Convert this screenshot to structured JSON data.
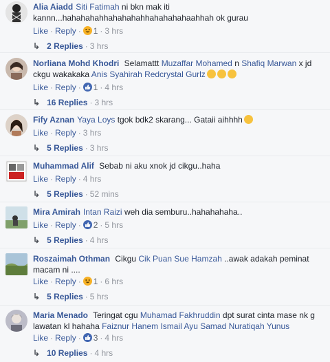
{
  "actions": {
    "like": "Like",
    "reply": "Reply",
    "sep": "·"
  },
  "comments": [
    {
      "author": "Alia Aiadd",
      "tag": "Siti Fatimah",
      "text": " ni bkn mak iti kannn...hahahahahhahahahahhahahahahaahhah ok gurau",
      "reaction": "haha",
      "reaction_count": "1",
      "time": "3 hrs",
      "replies": "2 Replies",
      "replies_time": "3 hrs"
    },
    {
      "author": "Norliana Mohd Khodri",
      "text_a": " Selamattt ",
      "tag_a": "Muzaffar Mohamed",
      "text_b": " n ",
      "tag_b": "Shafiq Marwan",
      "text_c": " x jd ckgu wakakaka ",
      "tag_c": "Anis Syahirah Redcrystal Gurlz",
      "emoji_count": 3,
      "reaction": "like",
      "reaction_count": "1",
      "time": "4 hrs",
      "replies": "16 Replies",
      "replies_time": "3 hrs"
    },
    {
      "author": "Fify Aznan",
      "tag": "Yaya Loys",
      "text": " tgok bdk2 skarang... Gataii aihhhh",
      "time": "3 hrs",
      "replies": "5 Replies",
      "replies_time": "3 hrs"
    },
    {
      "author": "Muhammad Alif",
      "text": " Sebab ni aku xnok jd cikgu..haha",
      "time": "4 hrs",
      "replies": "5 Replies",
      "replies_time": "52 mins"
    },
    {
      "author": "Mira Amirah",
      "tag": "Intan Raizi",
      "text": " weh dia semburu..hahahahaha..",
      "reaction": "like",
      "reaction_count": "2",
      "time": "5 hrs",
      "replies": "5 Replies",
      "replies_time": "4 hrs"
    },
    {
      "author": "Roszaimah Othman",
      "text_a": " Cikgu ",
      "tag": "Cik Puan Sue Hamzah",
      "text_b": " ..awak adakah peminat macam ni ....",
      "reaction": "haha",
      "reaction_count": "1",
      "time": "6 hrs",
      "replies": "5 Replies",
      "replies_time": "5 hrs"
    },
    {
      "author": "Maria Menado",
      "text_a": " Teringat cgu ",
      "tag_a": "Muhamad Fakhruddin",
      "text_b": " dpt surat cinta mase nk g lawatan kl hahaha ",
      "tag_b": "Faiznur Hanem Ismail",
      "text_c": " ",
      "tag_c": "Ayu Samad",
      "text_d": " ",
      "tag_d": "Nuratiqah Yunus",
      "reaction": "like",
      "reaction_count": "3",
      "time": "4 hrs",
      "replies": "10 Replies",
      "replies_time": "4 hrs"
    }
  ]
}
